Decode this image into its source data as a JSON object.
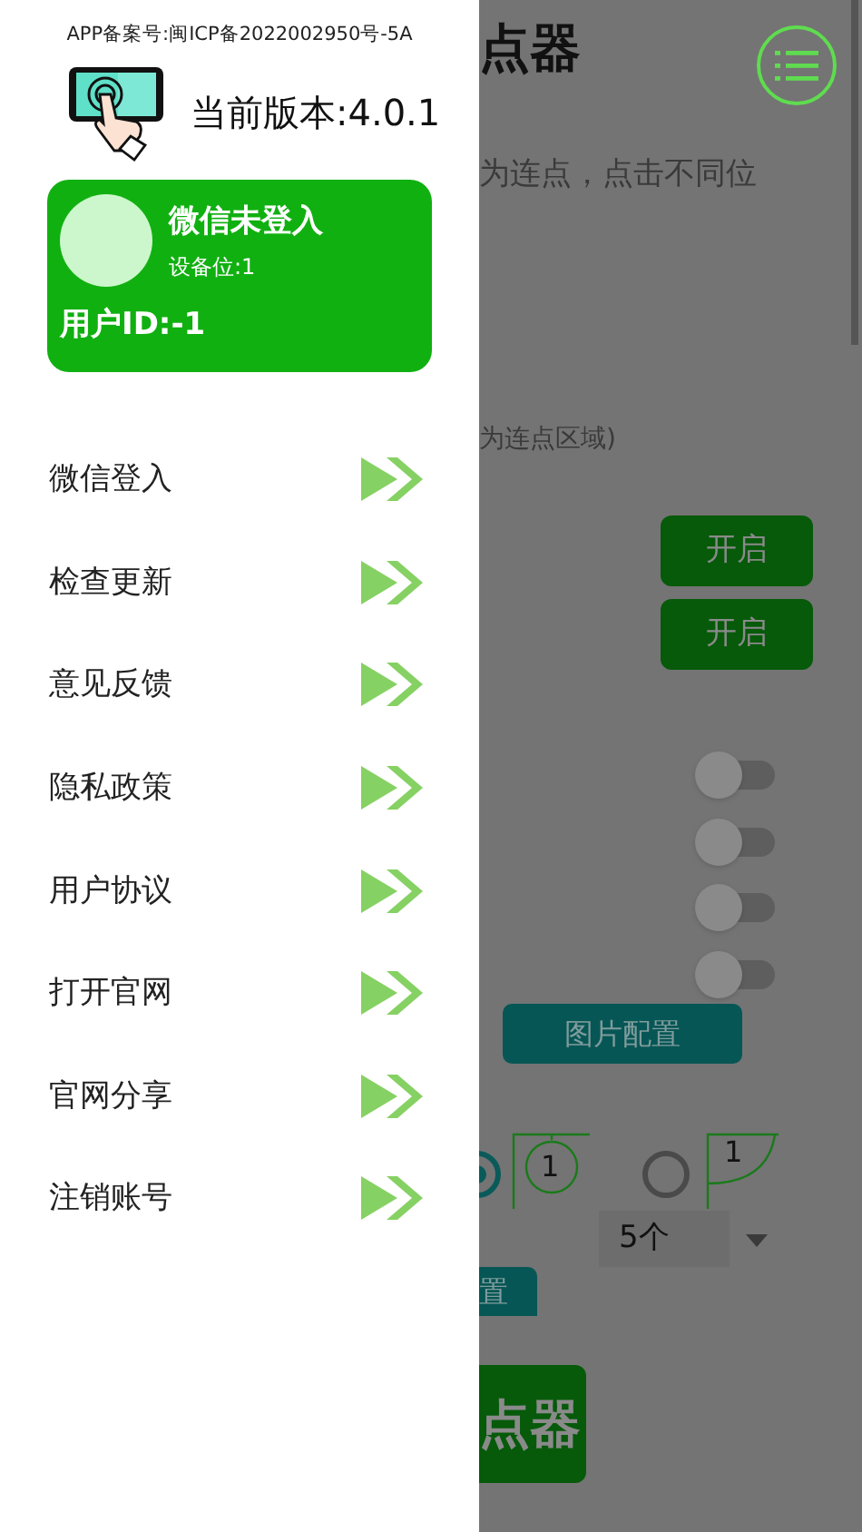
{
  "drawer": {
    "record_number": "APP备案号:闽ICP备2022002950号-5A",
    "version": "当前版本:4.0.1",
    "account_card": {
      "title": "微信未登入",
      "device": "设备位:1",
      "user_id": "用户ID:-1"
    },
    "menu": [
      {
        "label": "微信登入"
      },
      {
        "label": "检查更新"
      },
      {
        "label": "意见反馈"
      },
      {
        "label": "隐私政策"
      },
      {
        "label": "用户协议"
      },
      {
        "label": "打开官网"
      },
      {
        "label": "官网分享"
      },
      {
        "label": "注销账号"
      }
    ]
  },
  "background": {
    "title": "点器",
    "description": "为连点，点击不同位",
    "hint": "为连点区域)",
    "switch_buttons": [
      "开启",
      "开启"
    ],
    "toggles": [
      {
        "on": false
      },
      {
        "on": false
      },
      {
        "on": false
      },
      {
        "on": false
      }
    ],
    "image_config_button": "图片配置",
    "modes": [
      {
        "kind": "circle",
        "label": "1",
        "selected": true
      },
      {
        "kind": "quarter",
        "label": "1",
        "selected": false
      }
    ],
    "count_dropdown": "5个",
    "partial_button": "置",
    "start_button": "点器"
  }
}
